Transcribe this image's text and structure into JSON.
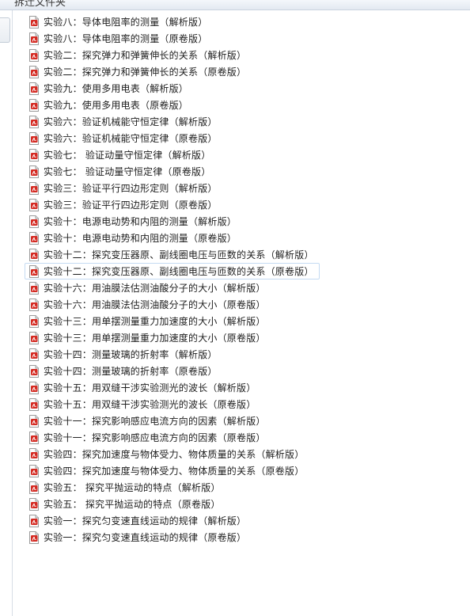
{
  "window": {
    "title": "拆迁文件夹"
  },
  "files": [
    {
      "name": "实验八：导体电阻率的测量（解析版）",
      "icon": "pdf-icon"
    },
    {
      "name": "实验八：导体电阻率的测量（原卷版）",
      "icon": "pdf-icon"
    },
    {
      "name": "实验二：探究弹力和弹簧伸长的关系（解析版）",
      "icon": "pdf-icon"
    },
    {
      "name": "实验二：探究弹力和弹簧伸长的关系（原卷版）",
      "icon": "pdf-icon"
    },
    {
      "name": "实验九：使用多用电表（解析版）",
      "icon": "pdf-icon"
    },
    {
      "name": "实验九：使用多用电表（原卷版）",
      "icon": "pdf-icon"
    },
    {
      "name": "实验六：验证机械能守恒定律（解析版）",
      "icon": "pdf-icon"
    },
    {
      "name": "实验六：验证机械能守恒定律（原卷版）",
      "icon": "pdf-icon"
    },
    {
      "name": "实验七： 验证动量守恒定律（解析版）",
      "icon": "pdf-icon"
    },
    {
      "name": "实验七： 验证动量守恒定律（原卷版）",
      "icon": "pdf-icon"
    },
    {
      "name": "实验三：验证平行四边形定则（解析版）",
      "icon": "pdf-icon"
    },
    {
      "name": "实验三：验证平行四边形定则（原卷版）",
      "icon": "pdf-icon"
    },
    {
      "name": "实验十：电源电动势和内阻的测量（解析版）",
      "icon": "pdf-icon"
    },
    {
      "name": "实验十：电源电动势和内阻的测量（原卷版）",
      "icon": "pdf-icon"
    },
    {
      "name": "实验十二：探究变压器原、副线圈电压与匝数的关系（解析版）",
      "icon": "pdf-icon"
    },
    {
      "name": "实验十二：探究变压器原、副线圈电压与匝数的关系（原卷版）",
      "icon": "pdf-icon",
      "focused": true
    },
    {
      "name": "实验十六：用油膜法估测油酸分子的大小（解析版）",
      "icon": "pdf-icon"
    },
    {
      "name": "实验十六：用油膜法估测油酸分子的大小（原卷版）",
      "icon": "pdf-icon"
    },
    {
      "name": "实验十三：用单摆测量重力加速度的大小（解析版）",
      "icon": "pdf-icon"
    },
    {
      "name": "实验十三：用单摆测量重力加速度的大小（原卷版）",
      "icon": "pdf-icon"
    },
    {
      "name": "实验十四：测量玻璃的折射率（解析版）",
      "icon": "pdf-icon"
    },
    {
      "name": "实验十四：测量玻璃的折射率（原卷版）",
      "icon": "pdf-icon"
    },
    {
      "name": "实验十五：用双缝干涉实验测光的波长（解析版）",
      "icon": "pdf-icon"
    },
    {
      "name": "实验十五：用双缝干涉实验测光的波长（原卷版）",
      "icon": "pdf-icon"
    },
    {
      "name": "实验十一：探究影响感应电流方向的因素（解析版）",
      "icon": "pdf-icon"
    },
    {
      "name": "实验十一：探究影响感应电流方向的因素（原卷版）",
      "icon": "pdf-icon"
    },
    {
      "name": "实验四：探究加速度与物体受力、物体质量的关系（解析版）",
      "icon": "pdf-icon"
    },
    {
      "name": "实验四：探究加速度与物体受力、物体质量的关系（原卷版）",
      "icon": "pdf-icon"
    },
    {
      "name": "实验五： 探究平抛运动的特点（解析版）",
      "icon": "pdf-icon"
    },
    {
      "name": "实验五： 探究平抛运动的特点（原卷版）",
      "icon": "pdf-icon"
    },
    {
      "name": "实验一：探究匀变速直线运动的规律（解析版）",
      "icon": "pdf-icon"
    },
    {
      "name": "实验一：探究匀变速直线运动的规律（原卷版）",
      "icon": "pdf-icon"
    }
  ],
  "colors": {
    "pdf_red": "#d42a22",
    "focus_border": "#c5dbf2"
  }
}
